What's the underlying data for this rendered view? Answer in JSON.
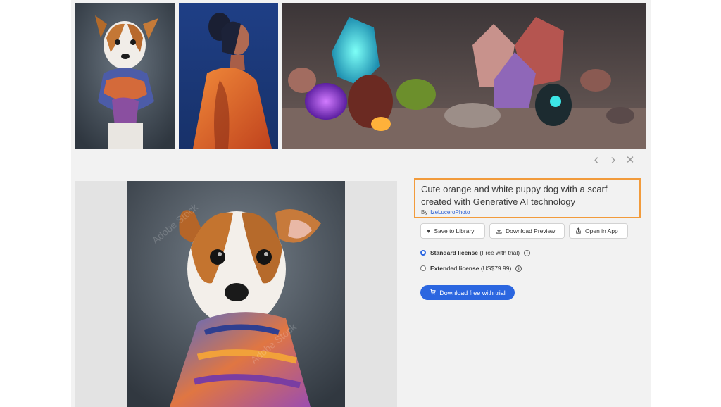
{
  "gallery": {
    "thumbnails": [
      {
        "subject": "puppy with scarf"
      },
      {
        "subject": "woman in orange"
      },
      {
        "subject": "glowing crystals"
      }
    ],
    "nav": {
      "prev_icon": "‹",
      "next_icon": "›",
      "close_icon": "✕"
    }
  },
  "asset": {
    "title": "Cute orange and white puppy dog with a scarf created with Generative AI technology",
    "by_label": "By",
    "author": "IlzeLuceroPhoto",
    "watermark": "Adobe Stock"
  },
  "actions": {
    "save": "Save to Library",
    "download_preview": "Download Preview",
    "open_in_app": "Open in App"
  },
  "licenses": {
    "standard": {
      "name": "Standard license",
      "detail": "(Free with trial)",
      "selected": true
    },
    "extended": {
      "name": "Extended license",
      "detail": "(US$79.99)",
      "selected": false
    }
  },
  "cta": {
    "label": "Download free with trial"
  },
  "colors": {
    "accent": "#2b66e0",
    "highlight_border": "#f29b3b",
    "link": "#2d5fd3"
  }
}
